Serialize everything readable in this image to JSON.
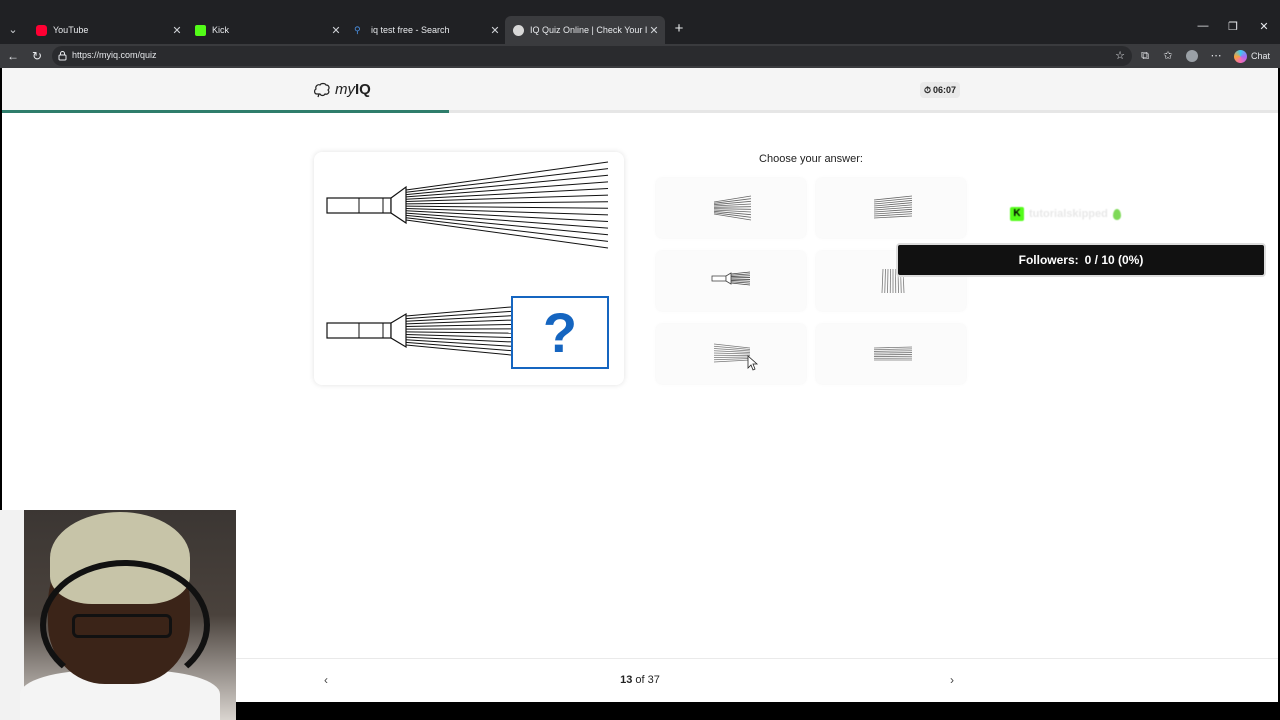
{
  "browser": {
    "tabs": [
      {
        "title": "YouTube",
        "favicon": "youtube-icon",
        "color": "#ff0033"
      },
      {
        "title": "Kick",
        "favicon": "kick-icon",
        "color": "#53fc18"
      },
      {
        "title": "iq test free - Search",
        "favicon": "search-icon",
        "color": "#4a90e2"
      },
      {
        "title": "IQ Quiz Online | Check Your IQ Sc",
        "favicon": "myiq-icon",
        "color": "#cccccc",
        "active": true
      }
    ],
    "url": "https://myiq.com/quiz",
    "chat_label": "Chat"
  },
  "header": {
    "logo_prefix": "my",
    "logo_bold": "IQ",
    "timer": "06:07",
    "progress_fraction": 0.35,
    "accent": "#2e7d6b"
  },
  "question": {
    "mark": "?",
    "mark_color": "#1565c0"
  },
  "answers": {
    "prompt": "Choose your answer:",
    "options": [
      {
        "id": "option-1",
        "icon": "fan-lines-icon"
      },
      {
        "id": "option-2",
        "icon": "parallel-lines-icon"
      },
      {
        "id": "option-3",
        "icon": "tube-with-lines-icon"
      },
      {
        "id": "option-4",
        "icon": "vertical-lines-icon"
      },
      {
        "id": "option-5",
        "icon": "converging-lines-icon"
      },
      {
        "id": "option-6",
        "icon": "parallel-lines-short-icon"
      }
    ]
  },
  "footer": {
    "current": "13",
    "of_label": "of",
    "total": "37",
    "prev_icon": "chevron-left-icon",
    "next_icon": "chevron-right-icon"
  },
  "overlay": {
    "kick_handle": "tutorialskipped",
    "followers_label": "Followers:",
    "followers_value": "0 / 10 (0%)"
  }
}
